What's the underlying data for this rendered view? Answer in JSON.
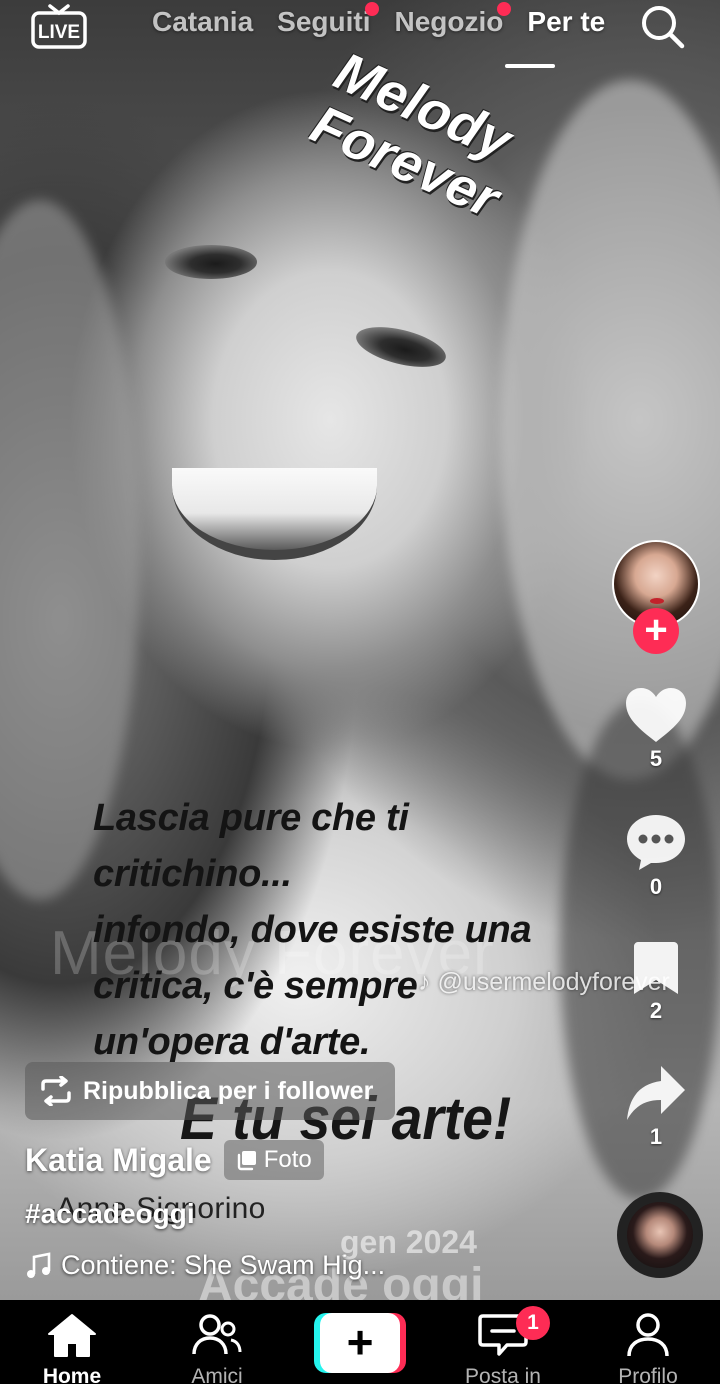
{
  "header": {
    "live_label": "LIVE",
    "tabs": [
      {
        "label": "Catania",
        "active": false,
        "has_dot": false
      },
      {
        "label": "Seguiti",
        "active": false,
        "has_dot": true
      },
      {
        "label": "Negozio",
        "active": false,
        "has_dot": true
      },
      {
        "label": "Per te",
        "active": true,
        "has_dot": false
      }
    ],
    "search_icon": "search-icon"
  },
  "post_image": {
    "watermark_line1": "Melody",
    "watermark_line2": "Forever",
    "ghost_watermark": "Melody Forever",
    "quote_lines": [
      "Lascia pure che ti",
      "critichino...",
      "infondo, dove esiste una",
      "critica, c'è sempre",
      "un'opera d'arte."
    ],
    "tagline": "E tu sei arte!",
    "credit": "-Anna Signorino",
    "handle_watermark": "@usermelodyforever",
    "date_stamp": "gen 2024",
    "stamp_name": "Accade oggi"
  },
  "actions": {
    "likes": "5",
    "comments": "0",
    "saves": "2",
    "shares": "1"
  },
  "info": {
    "repost_label": "Ripubblica per i follower",
    "author": "Katia Migale",
    "photo_badge": "Foto",
    "hashtag": "#accadeoggi",
    "sound": "Contiene: She Swam Hig..."
  },
  "bottom_nav": {
    "home": "Home",
    "friends": "Amici",
    "create": "+",
    "inbox": "Posta in arri",
    "inbox_badge": "1",
    "profile": "Profilo"
  },
  "colors": {
    "accent": "#fe2c55",
    "create_left": "#25f4ee",
    "create_right": "#fe2c55"
  }
}
